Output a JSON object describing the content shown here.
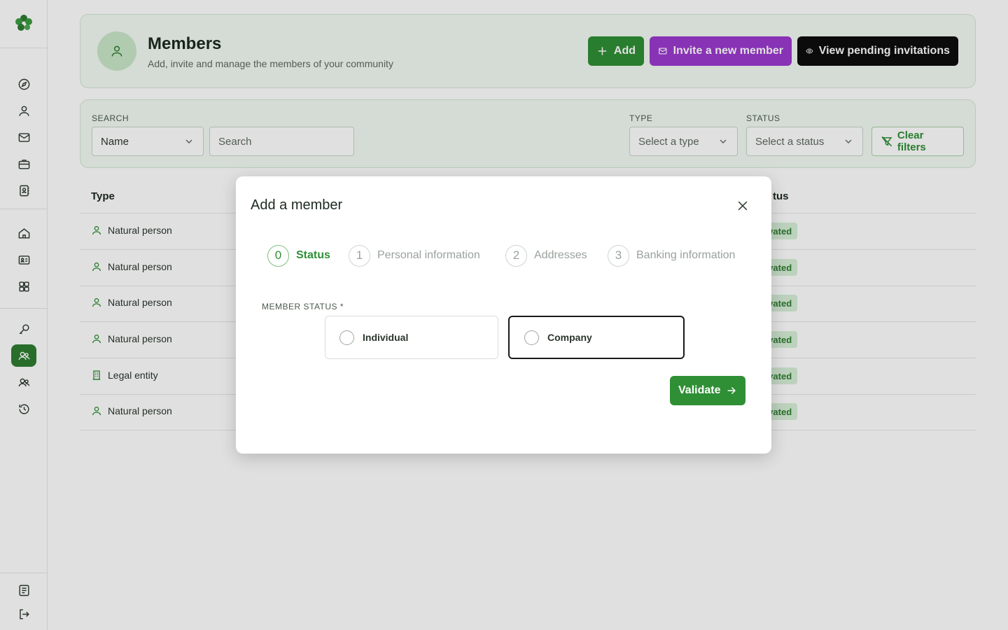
{
  "header": {
    "title": "Members",
    "subtitle": "Add, invite and manage the members of your community",
    "add_label": "Add",
    "invite_label": "Invite a new member",
    "pending_label": "View pending invitations"
  },
  "filters": {
    "search_label": "SEARCH",
    "search_field_value": "Name",
    "search_placeholder": "Search",
    "type_label": "TYPE",
    "type_placeholder": "Select a type",
    "status_label": "STATUS",
    "status_placeholder": "Select a status",
    "clear_label": "Clear filters"
  },
  "table": {
    "col_type": "Type",
    "col_status_partial": "tus",
    "rows": [
      {
        "type": "Natural person",
        "icon": "user-icon",
        "status": "ctivated"
      },
      {
        "type": "Natural person",
        "icon": "user-icon",
        "status": "ctivated"
      },
      {
        "type": "Natural person",
        "icon": "user-icon",
        "status": "ctivated"
      },
      {
        "type": "Natural person",
        "icon": "user-icon",
        "status": "ctivated"
      },
      {
        "type": "Legal entity",
        "icon": "building-icon",
        "status": "ctivated"
      },
      {
        "type": "Natural person",
        "icon": "user-icon",
        "status": "ctivated"
      }
    ]
  },
  "modal": {
    "title": "Add a member",
    "steps": [
      {
        "num": "0",
        "label": "Status",
        "active": true
      },
      {
        "num": "1",
        "label": "Personal information",
        "active": false
      },
      {
        "num": "2",
        "label": "Addresses",
        "active": false
      },
      {
        "num": "3",
        "label": "Banking information",
        "active": false
      }
    ],
    "member_status_label": "MEMBER STATUS *",
    "options": [
      {
        "label": "Individual",
        "selected": false
      },
      {
        "label": "Company",
        "selected": false
      }
    ],
    "validate_label": "Validate"
  },
  "colors": {
    "brand_green": "#2f8f35",
    "invite_purple": "#9b3ad0",
    "pending_black": "#0d0d0d"
  }
}
